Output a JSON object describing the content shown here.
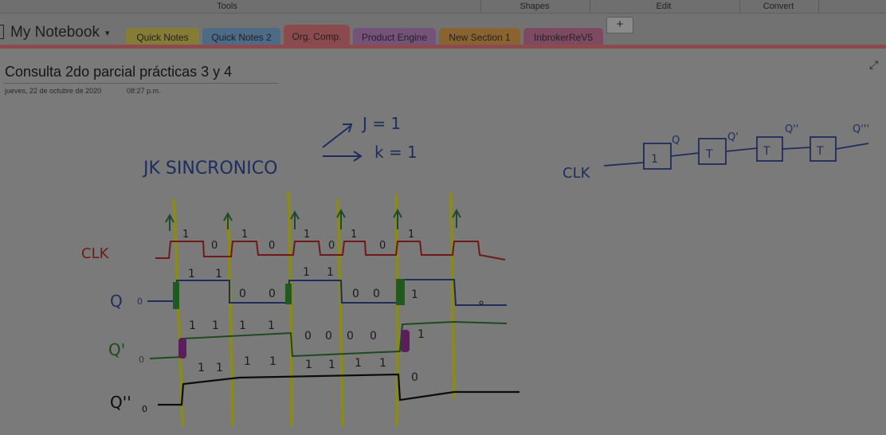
{
  "ribbon": {
    "groups": [
      "Tools",
      "Shapes",
      "Edit",
      "Convert"
    ]
  },
  "notebook": {
    "name": "My Notebook",
    "caret": "▾"
  },
  "tabs": [
    {
      "label": "Quick Notes",
      "color": "#857c36"
    },
    {
      "label": "Quick Notes 2",
      "color": "#4d6a86"
    },
    {
      "label": "Org. Comp.",
      "color": "#8a4a4e"
    },
    {
      "label": "Product Engine",
      "color": "#75527a"
    },
    {
      "label": "New Section 1",
      "color": "#8a6430"
    },
    {
      "label": "InbrokerReV5",
      "color": "#7d4a62"
    }
  ],
  "add_tab": "+",
  "page": {
    "title": "Consulta 2do parcial prácticas 3 y 4",
    "date": "jueves, 22 de octubre de 2020",
    "time": "08:27 p.m."
  },
  "ink": {
    "heading": "JK SINCRONICO",
    "j_eq": "J = 1",
    "k_eq": "k = 1",
    "clk_label": "CLK",
    "q_label": "Q",
    "q1_label": "Q'",
    "q2_label": "Q''",
    "zero": "0",
    "one": "1",
    "ff_label": "T",
    "q_out": "Q",
    "q1_out": "Q'",
    "q2_out": "Q''",
    "q3_out": "Q'''"
  },
  "colors": {
    "clk_wave": "#6e1a1a",
    "q_wave": "#1e2d5e",
    "q1_wave": "#1f4a1f",
    "q2_wave": "#0c0c0c",
    "guides": "#8a8a1a",
    "arrows": "#1f4a2e",
    "marker_green": "#1f5a1f",
    "marker_magenta": "#5a1e5a"
  }
}
